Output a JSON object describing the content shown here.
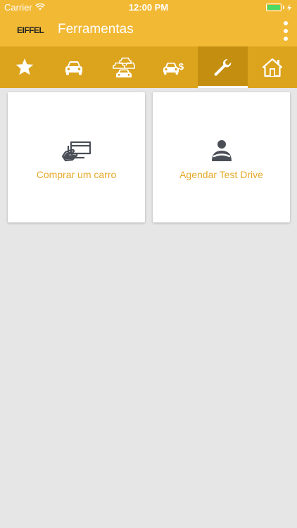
{
  "status_bar": {
    "carrier": "Carrier",
    "time": "12:00 PM",
    "battery_icon": "battery-full-icon",
    "wifi_icon": "wifi-icon"
  },
  "app_bar": {
    "logo_text": "EIFFEL",
    "title": "Ferramentas",
    "menu_icon": "more-vertical-icon"
  },
  "tabs": [
    {
      "icon": "star-icon",
      "active": false
    },
    {
      "icon": "car-icon",
      "active": false
    },
    {
      "icon": "cars-group-icon",
      "active": false
    },
    {
      "icon": "car-price-icon",
      "active": false
    },
    {
      "icon": "wrench-icon",
      "active": true
    },
    {
      "icon": "home-icon",
      "active": false
    }
  ],
  "cards": [
    {
      "label": "Comprar um carro",
      "icon": "payment-card-icon"
    },
    {
      "label": "Agendar Test Drive",
      "icon": "driver-icon"
    }
  ],
  "colors": {
    "primary": "#f2b935",
    "tab_bar": "#dca31d",
    "tab_active": "#c48f10",
    "accent_text": "#e6a92a",
    "background": "#e6e6e6",
    "icon_dark": "#4a4f57"
  }
}
